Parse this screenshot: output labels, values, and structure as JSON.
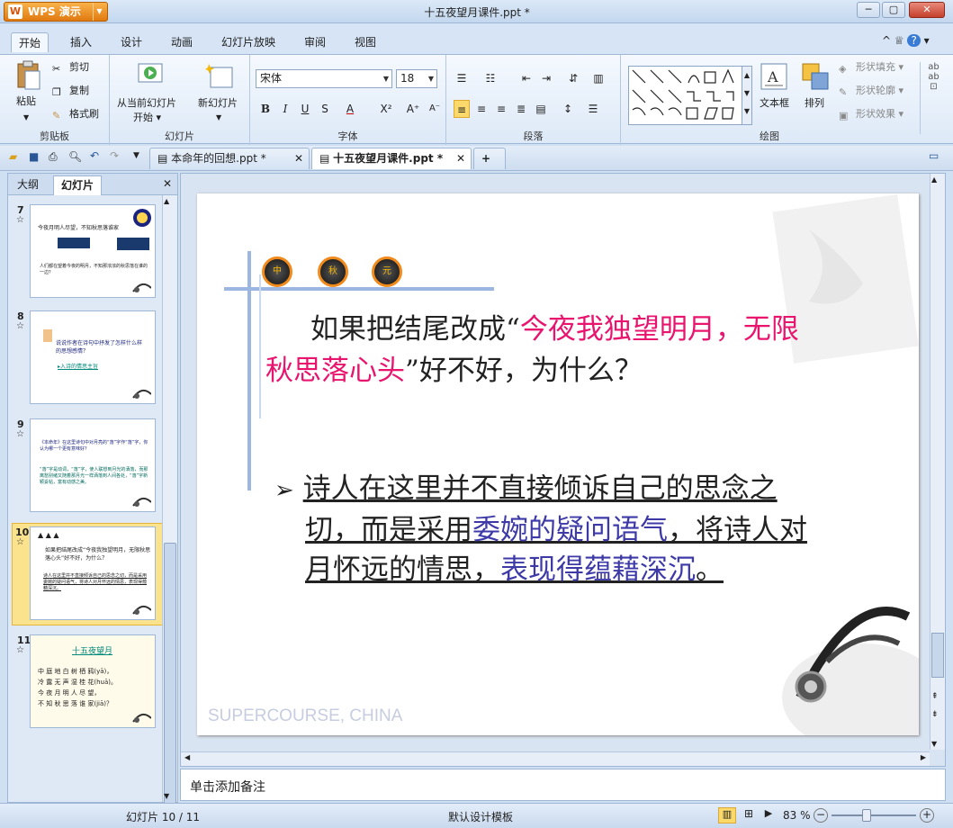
{
  "app": {
    "name": "WPS 演示",
    "window_title": "十五夜望月课件.ppt *"
  },
  "ribbon_tabs": [
    "开始",
    "插入",
    "设计",
    "动画",
    "幻灯片放映",
    "审阅",
    "视图"
  ],
  "clipboard": {
    "paste": "粘贴",
    "cut": "剪切",
    "copy": "复制",
    "format_painter": "格式刷",
    "group": "剪贴板"
  },
  "slides_group": {
    "from_current": "从当前幻灯片",
    "start": "开始",
    "new_slide": "新幻灯片",
    "group": "幻灯片"
  },
  "font": {
    "name": "宋体",
    "size": "18",
    "group": "字体"
  },
  "paragraph": {
    "group": "段落"
  },
  "drawing": {
    "textbox": "文本框",
    "arrange": "排列",
    "shape_fill": "形状填充",
    "shape_outline": "形状轮廓",
    "shape_effect": "形状效果",
    "group": "绘图"
  },
  "doc_tabs": [
    "本命年的回想.ppt *",
    "十五夜望月课件.ppt *"
  ],
  "pane": {
    "outline_tab": "大纲",
    "slides_tab": "幻灯片"
  },
  "thumbnails": [
    {
      "num": "7",
      "title": "今夜月明人尽望，不知秋思落谁家",
      "l1": "人们都在望着今夜的明月，不知那浓浓的秋思落在谁的一边？"
    },
    {
      "num": "8",
      "title": "说说作者在诗句中抒发了怎样什么样的思想感情？",
      "l1": "▸入诗的情思主旨"
    },
    {
      "num": "9",
      "title": "《本命年》在这里诗句中对月亮的“落”字作“落”字，你认为哪一个更有意味好？",
      "l1": "“落”字是动词，“落”字，使人联想到月光的洒落，而那离愁别绪又随着那月光一样洒落到人间各处，“落”字新颖妥帖，富有动感之美。"
    },
    {
      "num": "10",
      "title": "如果把结尾改成“今夜我独望明月，无限秋思落心头”好不好，为什么？",
      "l1": "诗人在这里并不直接倾诉自己的思念之切，而是采用委婉的疑问语气，将诗人对月怀远的情思，表现得蕴藉深沉。"
    },
    {
      "num": "11",
      "title": "十五夜望月",
      "lines": [
        "中 庭 地 白 树 栖 鸦(yā)，",
        "冷 露 无 声 湿 桂 花(huā)。",
        "今 夜 月 明 人 尽 望，",
        "不 知 秋 思 落 谁 家(jiā)？"
      ]
    }
  ],
  "slide": {
    "badges": [
      "中",
      "秋",
      "元"
    ],
    "question_pre": "如果把结尾改成“",
    "question_hl1": "今夜我独望明月，无限",
    "question_hl2": "秋思落心头",
    "question_post": "”好不好，为什么？",
    "bullet": "➢",
    "ans_a": "诗人在这里并不直接倾诉自己的思念之",
    "ans_b1": "切，而是采用",
    "ans_b2": "委婉的疑问语气",
    "ans_b3": "，将诗人对",
    "ans_c1": "月怀远的情思，",
    "ans_c2": "表现得蕴藉深沉",
    "ans_c3": "。",
    "watermark": "SUPERCOURSE, CHINA"
  },
  "notes_placeholder": "单击添加备注",
  "status": {
    "slide_info": "幻灯片 10 / 11",
    "template": "默认设计模板",
    "zoom": "83 %"
  },
  "colors": {
    "pink": "#e8146e",
    "purple": "#3d3aa8",
    "accent": "#7fa4d8"
  }
}
